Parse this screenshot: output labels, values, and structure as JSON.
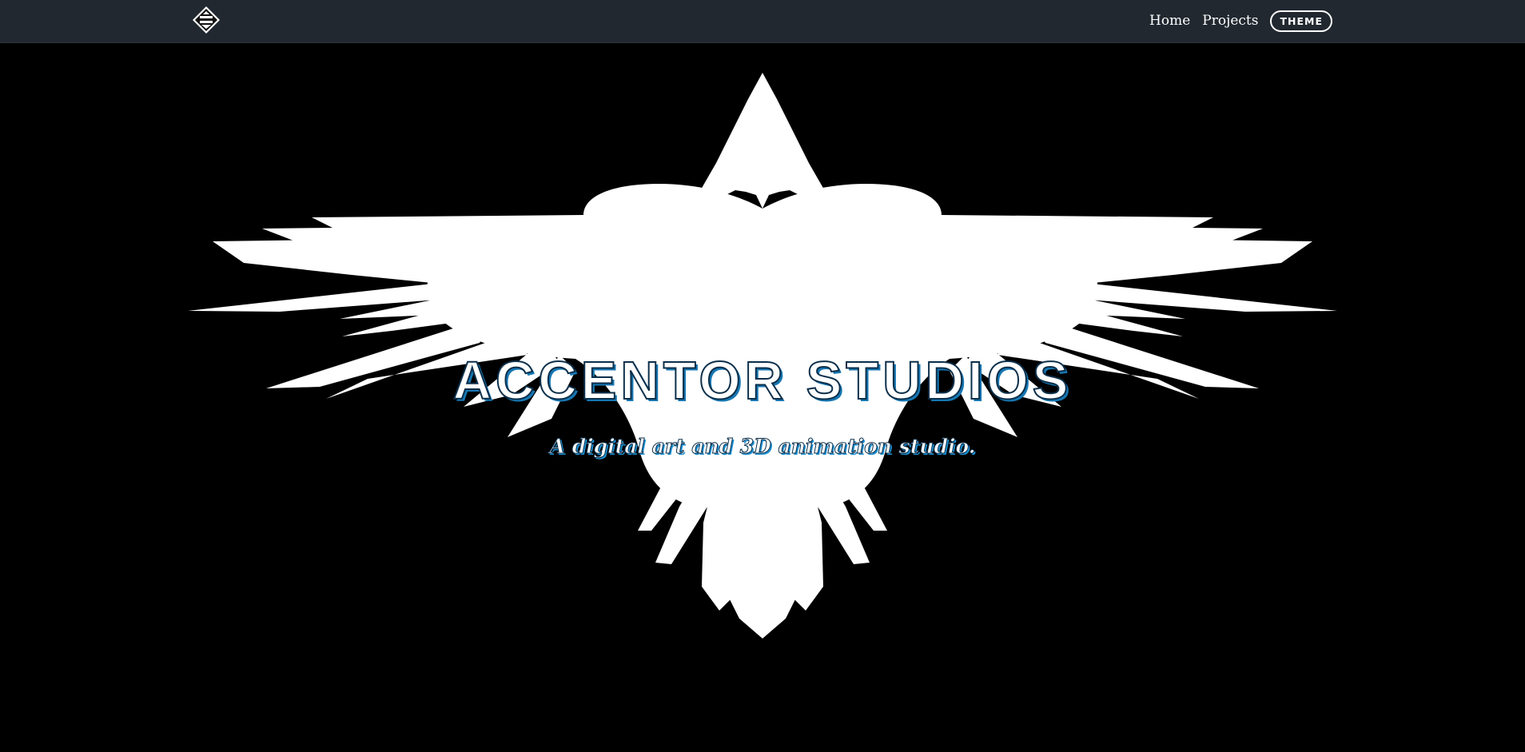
{
  "nav": {
    "logo_icon": "accentor-logo-icon",
    "links": [
      {
        "label": "Home"
      },
      {
        "label": "Projects"
      }
    ],
    "theme_button": "THEME"
  },
  "hero": {
    "emblem_icon": "bird-silhouette-icon",
    "title": "ACCENTOR STUDIOS",
    "subtitle": "A digital art and 3D animation studio."
  },
  "colors": {
    "navbar_bg": "#212830",
    "hero_bg": "#000000",
    "title_shadow": "#1677b3",
    "text": "#ffffff"
  }
}
